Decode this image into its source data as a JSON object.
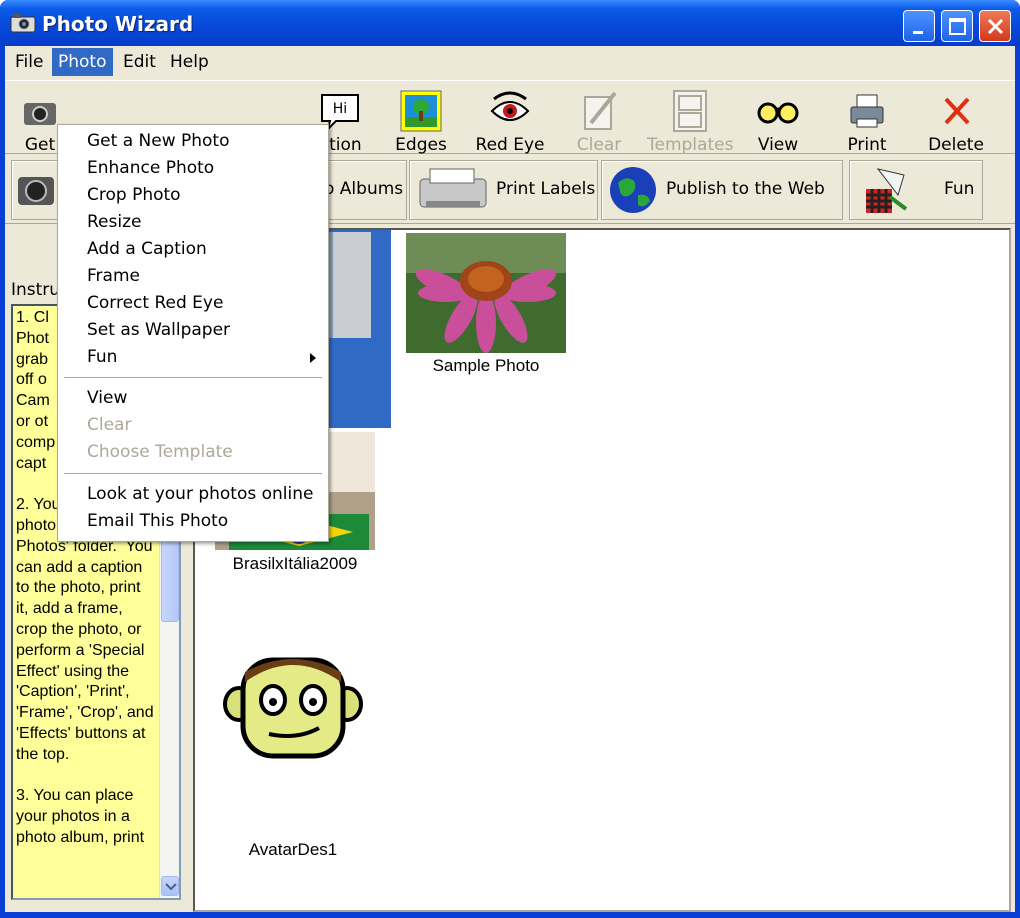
{
  "window": {
    "title": "Photo Wizard"
  },
  "menubar": {
    "items": [
      "File",
      "Photo",
      "Edit",
      "Help"
    ],
    "active": "Photo"
  },
  "toolbar": {
    "items": [
      {
        "label": "Get",
        "icon": "camera-icon",
        "enabled": true
      },
      {
        "label": "ption",
        "icon": "caption-bubble-icon",
        "bubble_text": "Hi",
        "enabled": true
      },
      {
        "label": "Edges",
        "icon": "edges-picture-icon",
        "enabled": true
      },
      {
        "label": "Red Eye",
        "icon": "red-eye-icon",
        "enabled": true
      },
      {
        "label": "Clear",
        "icon": "clear-eraser-icon",
        "enabled": false
      },
      {
        "label": "Templates",
        "icon": "templates-icon",
        "enabled": false
      },
      {
        "label": "View",
        "icon": "glasses-icon",
        "enabled": true
      },
      {
        "label": "Print",
        "icon": "printer-icon",
        "enabled": true
      },
      {
        "label": "Delete",
        "icon": "delete-x-icon",
        "enabled": true
      }
    ]
  },
  "linkbar": {
    "items": [
      {
        "label": "o Albums",
        "icon": "albums-icon"
      },
      {
        "label": "Print Labels",
        "icon": "label-printer-icon"
      },
      {
        "label": "Publish to the Web",
        "icon": "globe-icon"
      },
      {
        "label": "Fun",
        "icon": "fun-icon"
      }
    ]
  },
  "instructions": {
    "label": "Instru",
    "text": "1. Cl\nPhot\ngrab\noff o\nCam\nor ot\ncomp\ncapt\n\n2. You will see your photo in the 'My Photos' folder.  You can add a caption to the photo, print it, add a frame, crop the photo, or perform a 'Special Effect' using the 'Caption', 'Print', 'Frame', 'Crop', and 'Effects' buttons at the top.\n\n3. You can place your photos in a photo album, print"
  },
  "photos": [
    {
      "caption": "Sample Photo",
      "kind": "flower-photo"
    },
    {
      "caption": "BrasilxItália2009",
      "kind": "flag-photo"
    },
    {
      "caption": "AvatarDes1",
      "kind": "avatar-photo"
    }
  ],
  "photo_menu": {
    "items": [
      {
        "label": "Get a New Photo",
        "enabled": true
      },
      {
        "label": "Enhance Photo",
        "enabled": true
      },
      {
        "label": "Crop Photo",
        "enabled": true
      },
      {
        "label": "Resize",
        "enabled": true
      },
      {
        "label": "Add a Caption",
        "enabled": true
      },
      {
        "label": "Frame",
        "enabled": true
      },
      {
        "label": "Correct Red Eye",
        "enabled": true
      },
      {
        "label": "Set as Wallpaper",
        "enabled": true
      },
      {
        "label": "Fun",
        "enabled": true,
        "submenu": true
      },
      {
        "label": "View",
        "enabled": true
      },
      {
        "label": "Clear",
        "enabled": false
      },
      {
        "label": "Choose Template",
        "enabled": false
      },
      {
        "label": "Look at your photos online",
        "enabled": true
      },
      {
        "label": "Email This Photo",
        "enabled": true
      }
    ]
  },
  "colors": {
    "titlebar": "#0a5ae8",
    "menu_highlight": "#316ac5",
    "instructions_bg": "#ffff99",
    "selection": "#316ac5"
  }
}
